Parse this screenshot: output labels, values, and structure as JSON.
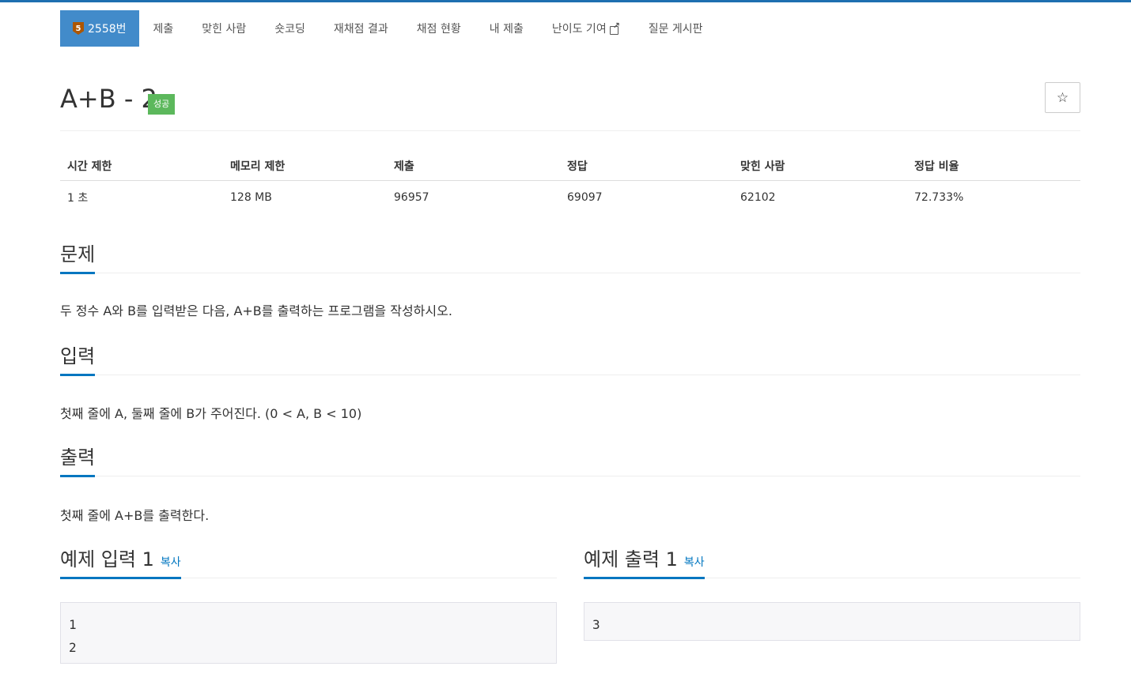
{
  "nav": {
    "problem_label": "2558번",
    "tier_icon": "5",
    "items": [
      "제출",
      "맞힌 사람",
      "숏코딩",
      "재채점 결과",
      "채점 현황",
      "내 제출",
      "난이도 기여",
      "질문 게시판"
    ]
  },
  "problem": {
    "title": "A+B - 2",
    "result": "성공",
    "star": "☆"
  },
  "info": {
    "headers": [
      "시간 제한",
      "메모리 제한",
      "제출",
      "정답",
      "맞힌 사람",
      "정답 비율"
    ],
    "values": [
      "1 초",
      "128 MB",
      "96957",
      "69097",
      "62102",
      "72.733%"
    ]
  },
  "sections": {
    "description_title": "문제",
    "description_text": "두 정수 A와 B를 입력받은 다음, A+B를 출력하는 프로그램을 작성하시오.",
    "input_title": "입력",
    "input_text": "첫째 줄에 A, 둘째 줄에 B가 주어진다. (0 < A, B < 10)",
    "output_title": "출력",
    "output_text": "첫째 줄에 A+B를 출력한다."
  },
  "samples": {
    "input_title": "예제 입력 1",
    "output_title": "예제 출력 1",
    "copy_label": "복사",
    "input_lines": [
      "1",
      "2"
    ],
    "output_lines": [
      "3"
    ]
  },
  "colors": {
    "accent": "#428bca",
    "success": "#5cb85c",
    "link": "#0076c0"
  }
}
